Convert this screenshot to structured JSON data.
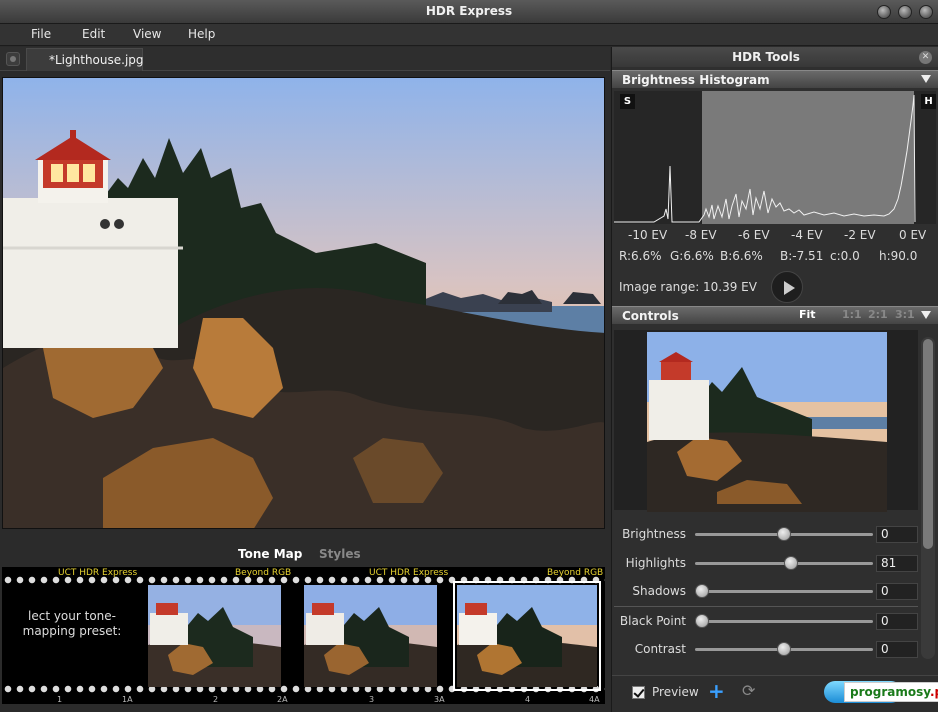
{
  "window": {
    "title": "HDR Express"
  },
  "menu": [
    "File",
    "Edit",
    "View",
    "Help"
  ],
  "document": {
    "tab": "*Lighthouse.jpg"
  },
  "tonebar": {
    "tone_map": "Tone Map",
    "styles": "Styles"
  },
  "filmstrip": {
    "labels": [
      "UCT HDR Express",
      "Beyond RGB",
      "UCT HDR Express",
      "Beyond RGB"
    ],
    "numbers": [
      "1",
      "1A",
      "2",
      "2A",
      "3",
      "3A",
      "4",
      "4A"
    ],
    "preset_text": "lect your tone-mapping preset:",
    "selected_frame": 3
  },
  "panel": {
    "title": "HDR Tools",
    "histogram": {
      "title": "Brightness Histogram",
      "shadow_btn": "S",
      "highlight_btn": "H",
      "ev_labels": [
        "-10 EV",
        "-8 EV",
        "-6 EV",
        "-4 EV",
        "-2 EV",
        "0 EV"
      ],
      "readouts": [
        "R:6.6%",
        "G:6.6%",
        "B:6.6%",
        "B:-7.51",
        "c:0.0",
        "h:90.0"
      ],
      "range_label": "Image range:",
      "range_value": "10.39 EV"
    },
    "controls": {
      "title": "Controls",
      "zoom": [
        "Fit",
        "1:1",
        "2:1",
        "3:1"
      ],
      "sliders": [
        {
          "label": "Brightness",
          "value": "0",
          "pos": 0.5
        },
        {
          "label": "Highlights",
          "value": "81",
          "pos": 0.54
        },
        {
          "label": "Shadows",
          "value": "0",
          "pos": 0.0
        },
        {
          "label": "Black Point",
          "value": "0",
          "pos": 0.0
        },
        {
          "label": "Contrast",
          "value": "0",
          "pos": 0.5
        }
      ]
    },
    "footer": {
      "preview_label": "Preview",
      "preview_checked": true,
      "watermark_main": "programosy",
      "watermark_tld": ".pl"
    }
  }
}
